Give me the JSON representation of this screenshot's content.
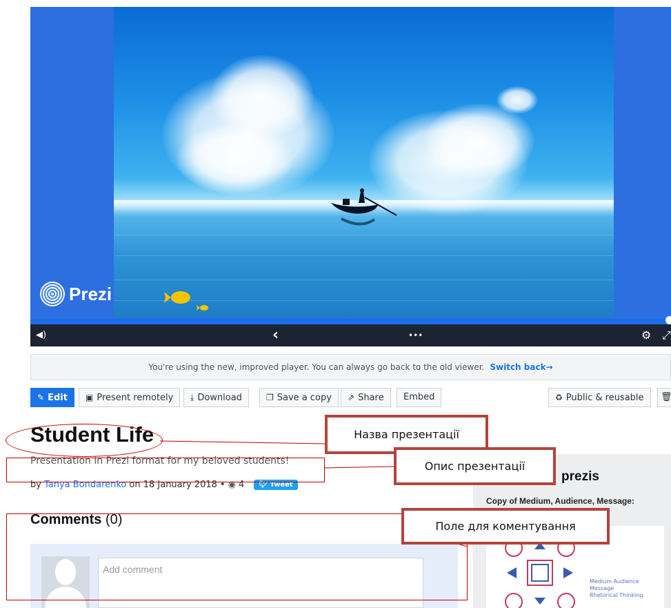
{
  "player": {
    "logo_text": "Prezi",
    "controls": {
      "volume_icon": "◀)",
      "prev_icon": "‹",
      "more_icon": "•••",
      "settings_icon": "⚙",
      "fullscreen_icon": "⤢"
    }
  },
  "notice": {
    "text": "You're using the new, improved player. You can always go back to the old viewer.",
    "link": "Switch back→"
  },
  "toolbar": {
    "edit": "Edit",
    "present_remotely": "Present remotely",
    "download": "Download",
    "save_copy": "Save a copy",
    "share": "Share",
    "embed": "Embed",
    "public": "Public & reusable"
  },
  "presentation": {
    "title": "Student Life",
    "description": "Presentation in Prezi format for my beloved students!",
    "by": "by",
    "author": "Tanya Bondarenko",
    "date": "on 18 January 2018",
    "bullet": "•",
    "views": "4",
    "tweet": "Tweet"
  },
  "comments": {
    "title": "Comments",
    "count": "(0)",
    "placeholder": "Add comment"
  },
  "sidebar": {
    "title": "prezis",
    "item_title": "Copy of Medium, Audience, Message:",
    "thumb_caption_1": "Medium Audience Message",
    "thumb_caption_2": "Rhetorical Thinking"
  },
  "annotations": {
    "title_label": "Назва презентації",
    "desc_label": "Опис презентації",
    "comment_label": "Поле для коментування"
  },
  "colors": {
    "accent": "#1b73e8",
    "annotation": "#b3443d"
  }
}
